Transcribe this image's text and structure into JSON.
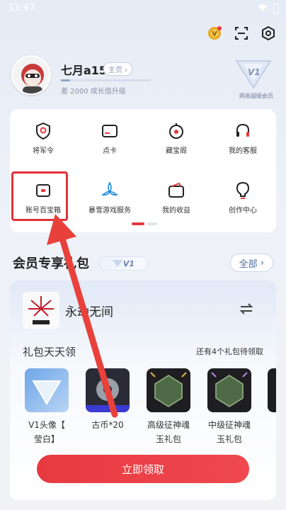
{
  "status_bar": {
    "time": "11:47"
  },
  "profile": {
    "nickname": "七月a152",
    "homepage_label": "主页",
    "growth_text": "差 2000 成长值升级",
    "progress_fraction": 0.1,
    "vip_level": "V1",
    "vip_label": "网易超级会员"
  },
  "services": [
    {
      "label": "将军令",
      "icon": "shield-token-icon"
    },
    {
      "label": "点卡",
      "icon": "card-icon"
    },
    {
      "label": "藏宝阁",
      "icon": "treasure-icon"
    },
    {
      "label": "我的客服",
      "icon": "headset-icon"
    },
    {
      "label": "账号百宝箱",
      "icon": "toolbox-icon"
    },
    {
      "label": "暴雪游戏服务",
      "icon": "battlenet-icon"
    },
    {
      "label": "我的收益",
      "icon": "wallet-icon"
    },
    {
      "label": "创作中心",
      "icon": "bulb-icon"
    }
  ],
  "member": {
    "section_title": "会员专享礼包",
    "tag": "V1",
    "all_label": "全部"
  },
  "gift_card": {
    "game_name": "永劫无间",
    "daily_title": "礼包天天领",
    "remaining_text": "还有4个礼包待领取",
    "gifts": [
      {
        "label_line1": "V1头像【",
        "label_line2": "莹白】"
      },
      {
        "label_line1": "古币*20",
        "label_line2": ""
      },
      {
        "label_line1": "高级征神魂",
        "label_line2": "玉礼包"
      },
      {
        "label_line1": "中级征神魂",
        "label_line2": "玉礼包"
      }
    ],
    "claim_label": "立即领取"
  },
  "colors": {
    "accent_red": "#e63a40",
    "link_blue": "#4a6ea3",
    "highlight_red": "#e0323a"
  }
}
